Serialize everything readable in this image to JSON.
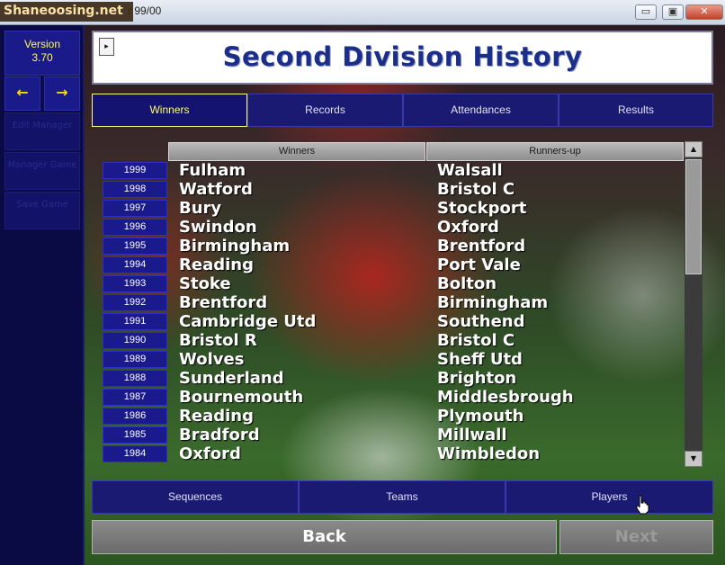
{
  "window": {
    "title_suffix": "r 99/00",
    "watermark": "Shaneoosing.net",
    "minimize": "▭",
    "maximize": "▣",
    "close": "✕"
  },
  "sidebar": {
    "version_label": "Version",
    "version_number": "3.70",
    "back_arrow": "←",
    "forward_arrow": "→",
    "slots": [
      "Edit Manager",
      "Manager Game",
      "Save Game"
    ]
  },
  "header": {
    "menu_toggle": "▸",
    "title": "Second Division History"
  },
  "tabs": [
    {
      "label": "Winners",
      "active": true
    },
    {
      "label": "Records",
      "active": false
    },
    {
      "label": "Attendances",
      "active": false
    },
    {
      "label": "Results",
      "active": false
    }
  ],
  "table": {
    "columns": [
      "Winners",
      "Runners-up"
    ],
    "rows": [
      {
        "year": "1999",
        "winner": "Fulham",
        "runner_up": "Walsall"
      },
      {
        "year": "1998",
        "winner": "Watford",
        "runner_up": "Bristol C"
      },
      {
        "year": "1997",
        "winner": "Bury",
        "runner_up": "Stockport"
      },
      {
        "year": "1996",
        "winner": "Swindon",
        "runner_up": "Oxford"
      },
      {
        "year": "1995",
        "winner": "Birmingham",
        "runner_up": "Brentford"
      },
      {
        "year": "1994",
        "winner": "Reading",
        "runner_up": "Port Vale"
      },
      {
        "year": "1993",
        "winner": "Stoke",
        "runner_up": "Bolton"
      },
      {
        "year": "1992",
        "winner": "Brentford",
        "runner_up": "Birmingham"
      },
      {
        "year": "1991",
        "winner": "Cambridge Utd",
        "runner_up": "Southend"
      },
      {
        "year": "1990",
        "winner": "Bristol R",
        "runner_up": "Bristol C"
      },
      {
        "year": "1989",
        "winner": "Wolves",
        "runner_up": "Sheff Utd"
      },
      {
        "year": "1988",
        "winner": "Sunderland",
        "runner_up": "Brighton"
      },
      {
        "year": "1987",
        "winner": "Bournemouth",
        "runner_up": "Middlesbrough"
      },
      {
        "year": "1986",
        "winner": "Reading",
        "runner_up": "Plymouth"
      },
      {
        "year": "1985",
        "winner": "Bradford",
        "runner_up": "Millwall"
      },
      {
        "year": "1984",
        "winner": "Oxford",
        "runner_up": "Wimbledon"
      }
    ],
    "scroll_up": "▲",
    "scroll_down": "▼"
  },
  "bottom_tabs": [
    "Sequences",
    "Teams",
    "Players"
  ],
  "actions": {
    "back": "Back",
    "next": "Next"
  },
  "colors": {
    "panel_blue": "#1a1a72",
    "active_yellow": "#ffff70",
    "title_blue": "#1a2e8a"
  }
}
